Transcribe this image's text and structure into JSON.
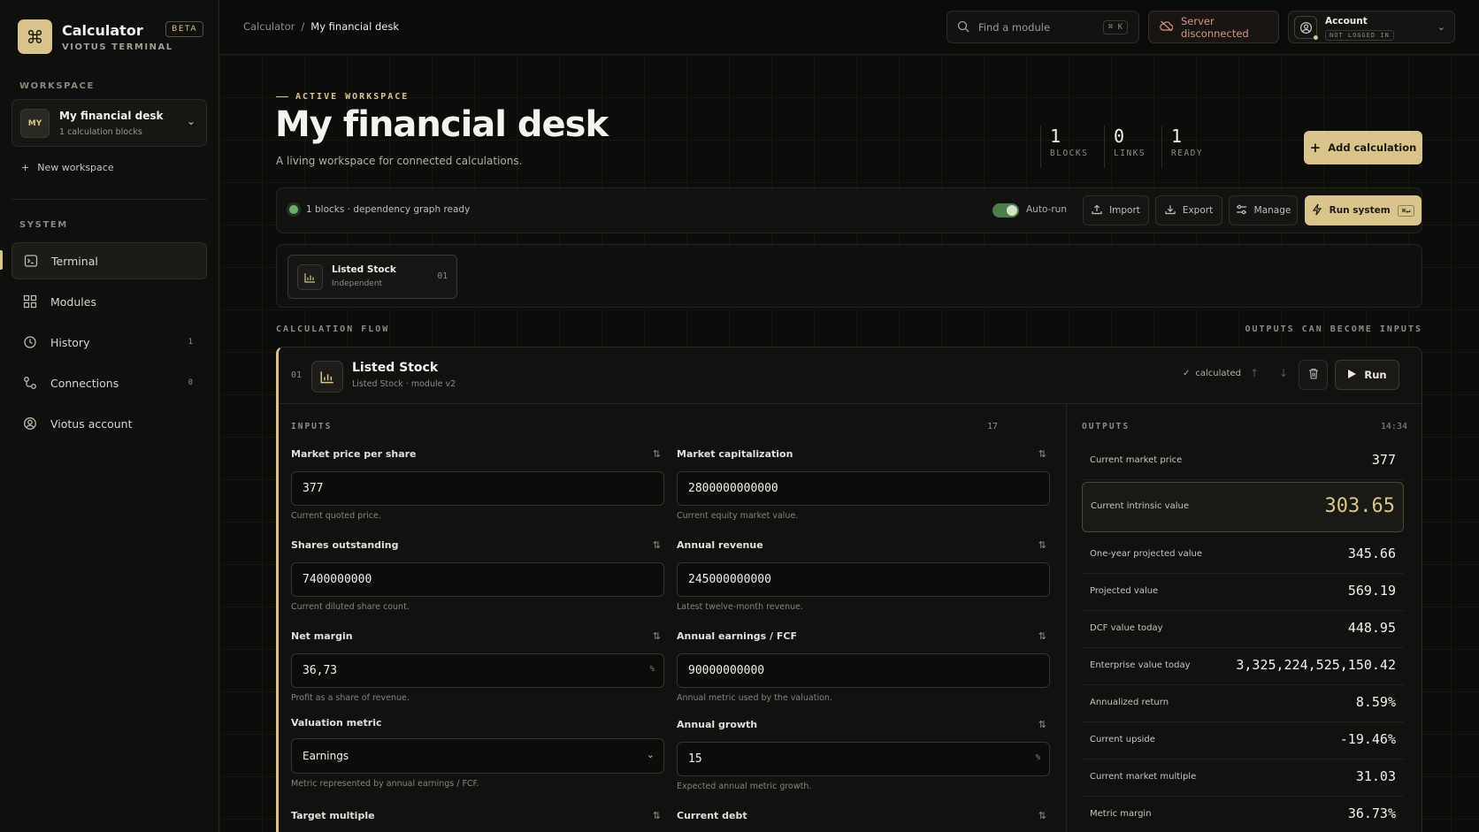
{
  "brand": {
    "title": "Calculator",
    "subtitle": "VIOTUS TERMINAL",
    "badge": "BETA"
  },
  "sidebar": {
    "workspace_label": "WORKSPACE",
    "workspace": {
      "avatar": "MY",
      "name": "My financial desk",
      "meta": "1 calculation blocks"
    },
    "new_workspace": "New workspace",
    "system_label": "SYSTEM",
    "items": [
      {
        "label": "Terminal",
        "icon": "terminal-icon",
        "count": ""
      },
      {
        "label": "Modules",
        "icon": "modules-icon",
        "count": ""
      },
      {
        "label": "History",
        "icon": "history-icon",
        "count": "1"
      },
      {
        "label": "Connections",
        "icon": "connections-icon",
        "count": "0"
      },
      {
        "label": "Viotus account",
        "icon": "account-icon",
        "count": ""
      }
    ]
  },
  "topbar": {
    "breadcrumb": [
      "Calculator",
      "My financial desk"
    ],
    "search_placeholder": "Find a module",
    "search_kbd": "⌘ K",
    "server_status": "Server disconnected",
    "account": {
      "name": "Account",
      "state": "NOT LOGGED IN"
    }
  },
  "header": {
    "kicker": "ACTIVE WORKSPACE",
    "title": "My financial desk",
    "subtitle": "A living workspace for connected calculations.",
    "stats": [
      {
        "value": "1",
        "label": "BLOCKS"
      },
      {
        "value": "0",
        "label": "LINKS"
      },
      {
        "value": "1",
        "label": "READY"
      }
    ],
    "add_button": "Add calculation"
  },
  "toolbar": {
    "status": "1 blocks · dependency graph ready",
    "autorun_label": "Auto-run",
    "autorun_on": true,
    "import": "Import",
    "export": "Export",
    "manage": "Manage",
    "run_system": "Run system",
    "run_kbd": "⌘↵"
  },
  "chip": {
    "title": "Listed Stock",
    "sub": "Independent",
    "num": "01"
  },
  "flow": {
    "label": "CALCULATION FLOW",
    "right": "OUTPUTS CAN BECOME INPUTS"
  },
  "block": {
    "num": "01",
    "title": "Listed Stock",
    "sub": "Listed Stock · module v2",
    "status": "calculated",
    "run": "Run",
    "inputs_label": "INPUTS",
    "inputs_count": "17",
    "fields": [
      {
        "label": "Market price per share",
        "value": "377",
        "unit": "",
        "help": "Current quoted price."
      },
      {
        "label": "Market capitalization",
        "value": "2800000000000",
        "unit": "",
        "help": "Current equity market value."
      },
      {
        "label": "Shares outstanding",
        "value": "7400000000",
        "unit": "",
        "help": "Current diluted share count."
      },
      {
        "label": "Annual revenue",
        "value": "245000000000",
        "unit": "",
        "help": "Latest twelve-month revenue."
      },
      {
        "label": "Net margin",
        "value": "36,73",
        "unit": "%",
        "help": "Profit as a share of revenue."
      },
      {
        "label": "Annual earnings / FCF",
        "value": "90000000000",
        "unit": "",
        "help": "Annual metric used by the valuation."
      },
      {
        "label": "Valuation metric",
        "value": "Earnings",
        "unit": "",
        "help": "Metric represented by annual earnings / FCF."
      },
      {
        "label": "Annual growth",
        "value": "15",
        "unit": "%",
        "help": "Expected annual metric growth."
      },
      {
        "label": "Target multiple",
        "value": "",
        "unit": "",
        "help": ""
      },
      {
        "label": "Current debt",
        "value": "",
        "unit": "",
        "help": ""
      }
    ],
    "outputs_label": "OUTPUTS",
    "outputs_time": "14:34",
    "outputs": [
      {
        "label": "Current market price",
        "value": "377"
      },
      {
        "label": "Current intrinsic value",
        "value": "303.65"
      },
      {
        "label": "One-year projected value",
        "value": "345.66"
      },
      {
        "label": "Projected value",
        "value": "569.19"
      },
      {
        "label": "DCF value today",
        "value": "448.95"
      },
      {
        "label": "Enterprise value today",
        "value": "3,325,224,525,150.42"
      },
      {
        "label": "Annualized return",
        "value": "8.59%"
      },
      {
        "label": "Current upside",
        "value": "-19.46%"
      },
      {
        "label": "Current market multiple",
        "value": "31.03"
      },
      {
        "label": "Metric margin",
        "value": "36.73%"
      }
    ]
  },
  "colors": {
    "accent": "#d9c48c",
    "background": "#0b0b09",
    "ok": "#6fae6a",
    "warn": "#cf9a85"
  }
}
